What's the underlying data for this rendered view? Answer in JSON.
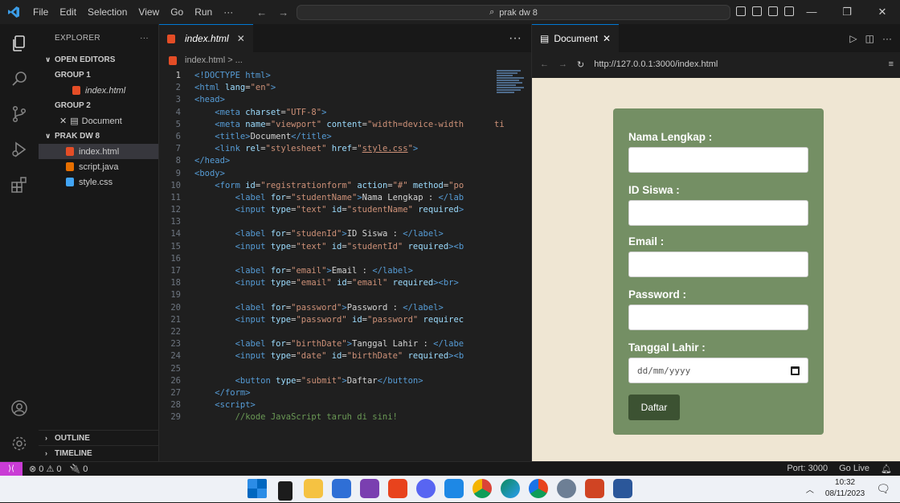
{
  "titlebar": {
    "menu": [
      "File",
      "Edit",
      "Selection",
      "View",
      "Go",
      "Run",
      "···"
    ],
    "search_text": "prak dw 8"
  },
  "sidebar": {
    "title": "EXPLORER",
    "more": "···",
    "open_editors": "OPEN EDITORS",
    "group1": "GROUP 1",
    "group1_file": "index.html",
    "group2": "GROUP 2",
    "group2_file": "Document",
    "project": "PRAK DW 8",
    "files": [
      "index.html",
      "script.java",
      "style.css"
    ],
    "outline": "OUTLINE",
    "timeline": "TIMELINE"
  },
  "editor": {
    "tab_label": "index.html",
    "breadcrumb": "index.html > ...",
    "more": "···",
    "lines": [
      {
        "n": "1",
        "html": "<span class='tg'>&lt;!DOCTYPE html&gt;</span>"
      },
      {
        "n": "2",
        "html": "<span class='tg'>&lt;html</span> <span class='at'>lang</span>=<span class='st'>\"en\"</span><span class='tg'>&gt;</span>"
      },
      {
        "n": "3",
        "html": "<span class='tg'>&lt;head&gt;</span>"
      },
      {
        "n": "4",
        "html": "    <span class='tg'>&lt;meta</span> <span class='at'>charset</span>=<span class='st'>\"UTF-8\"</span><span class='tg'>&gt;</span>"
      },
      {
        "n": "5",
        "html": "    <span class='tg'>&lt;meta</span> <span class='at'>name</span>=<span class='st'>\"viewport\"</span> <span class='at'>content</span>=<span class='st'>\"width=device-width</span>      <span class='st'>ti</span>"
      },
      {
        "n": "6",
        "html": "    <span class='tg'>&lt;title&gt;</span><span class='tx'>Document</span><span class='tg'>&lt;/title&gt;</span>"
      },
      {
        "n": "7",
        "html": "    <span class='tg'>&lt;link</span> <span class='at'>rel</span>=<span class='st'>\"stylesheet\"</span> <span class='at'>href</span>=<span class='st'>\"<u>style.css</u>\"</span><span class='tg'>&gt;</span>"
      },
      {
        "n": "8",
        "html": "<span class='tg'>&lt;/head&gt;</span>"
      },
      {
        "n": "9",
        "html": "<span class='tg'>&lt;body&gt;</span>"
      },
      {
        "n": "10",
        "html": "    <span class='tg'>&lt;form</span> <span class='at'>id</span>=<span class='st'>\"registrationform\"</span> <span class='at'>action</span>=<span class='st'>\"#\"</span> <span class='at'>method</span>=<span class='st'>\"po</span>"
      },
      {
        "n": "11",
        "html": "        <span class='tg'>&lt;label</span> <span class='at'>for</span>=<span class='st'>\"studentName\"</span><span class='tg'>&gt;</span><span class='tx'>Nama Lengkap : </span><span class='tg'>&lt;/lab</span>"
      },
      {
        "n": "12",
        "html": "        <span class='tg'>&lt;input</span> <span class='at'>type</span>=<span class='st'>\"text\"</span> <span class='at'>id</span>=<span class='st'>\"studentName\"</span> <span class='at'>required</span><span class='tg'>&gt;</span>"
      },
      {
        "n": "13",
        "html": ""
      },
      {
        "n": "14",
        "html": "        <span class='tg'>&lt;label</span> <span class='at'>for</span>=<span class='st'>\"studenId\"</span><span class='tg'>&gt;</span><span class='tx'>ID Siswa : </span><span class='tg'>&lt;/label&gt;</span>"
      },
      {
        "n": "15",
        "html": "        <span class='tg'>&lt;input</span> <span class='at'>type</span>=<span class='st'>\"text\"</span> <span class='at'>id</span>=<span class='st'>\"studentId\"</span> <span class='at'>required</span><span class='tg'>&gt;&lt;b</span>"
      },
      {
        "n": "16",
        "html": ""
      },
      {
        "n": "17",
        "html": "        <span class='tg'>&lt;label</span> <span class='at'>for</span>=<span class='st'>\"email\"</span><span class='tg'>&gt;</span><span class='tx'>Email : </span><span class='tg'>&lt;/label&gt;</span>"
      },
      {
        "n": "18",
        "html": "        <span class='tg'>&lt;input</span> <span class='at'>type</span>=<span class='st'>\"email\"</span> <span class='at'>id</span>=<span class='st'>\"email\"</span> <span class='at'>required</span><span class='tg'>&gt;&lt;br&gt;</span>"
      },
      {
        "n": "19",
        "html": ""
      },
      {
        "n": "20",
        "html": "        <span class='tg'>&lt;label</span> <span class='at'>for</span>=<span class='st'>\"password\"</span><span class='tg'>&gt;</span><span class='tx'>Password : </span><span class='tg'>&lt;/label&gt;</span>"
      },
      {
        "n": "21",
        "html": "        <span class='tg'>&lt;input</span> <span class='at'>type</span>=<span class='st'>\"password\"</span> <span class='at'>id</span>=<span class='st'>\"password\"</span> <span class='at'>requirec</span>"
      },
      {
        "n": "22",
        "html": ""
      },
      {
        "n": "23",
        "html": "        <span class='tg'>&lt;label</span> <span class='at'>for</span>=<span class='st'>\"birthDate\"</span><span class='tg'>&gt;</span><span class='tx'>Tanggal Lahir : </span><span class='tg'>&lt;/labe</span>"
      },
      {
        "n": "24",
        "html": "        <span class='tg'>&lt;input</span> <span class='at'>type</span>=<span class='st'>\"date\"</span> <span class='at'>id</span>=<span class='st'>\"birthDate\"</span> <span class='at'>required</span><span class='tg'>&gt;&lt;b</span>"
      },
      {
        "n": "25",
        "html": ""
      },
      {
        "n": "26",
        "html": "        <span class='tg'>&lt;button</span> <span class='at'>type</span>=<span class='st'>\"submit\"</span><span class='tg'>&gt;</span><span class='tx'>Daftar</span><span class='tg'>&lt;/button&gt;</span>"
      },
      {
        "n": "27",
        "html": "    <span class='tg'>&lt;/form&gt;</span>"
      },
      {
        "n": "28",
        "html": "    <span class='tg'>&lt;script&gt;</span>"
      },
      {
        "n": "29",
        "html": "        <span class='cm'>//kode JavaScript taruh di sini!</span>"
      }
    ]
  },
  "preview": {
    "tab_label": "Document",
    "url": "http://127.0.0.1:3000/index.html",
    "form": {
      "name_label": "Nama Lengkap :",
      "id_label": "ID Siswa :",
      "email_label": "Email :",
      "password_label": "Password :",
      "birth_label": "Tanggal Lahir :",
      "birth_placeholder": "dd/mm/yyyy",
      "submit_label": "Daftar"
    }
  },
  "statusbar": {
    "problems": "⊗ 0 ⚠ 0",
    "ports": "🔌 0",
    "port": "Port: 3000",
    "golive": "Go Live"
  },
  "taskbar": {
    "time": "10:32",
    "date": "08/11/2023"
  },
  "colors": {
    "accent": "#0078d4",
    "form_card": "#748f64",
    "page_bg": "#efe6d3",
    "button": "#3c5232"
  }
}
